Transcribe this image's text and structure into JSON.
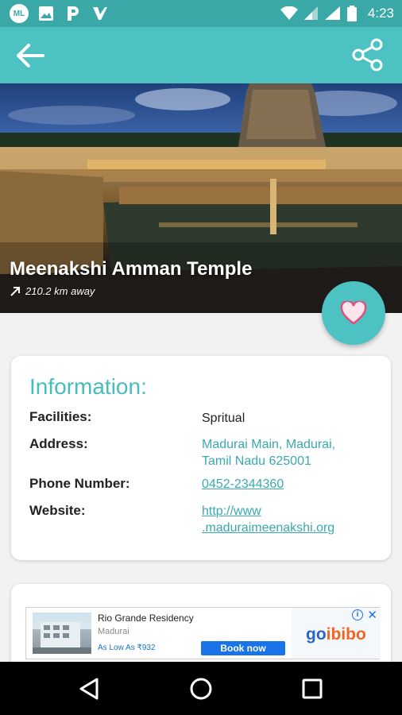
{
  "status_bar": {
    "time": "4:23",
    "notification_icons": [
      "ml-app-icon",
      "image-icon",
      "parking-icon",
      "checkmark-app-icon"
    ],
    "system_icons": [
      "wifi-icon",
      "signal-icon",
      "signal-icon",
      "battery-icon"
    ]
  },
  "app_bar": {
    "back_icon": "arrow-left-icon",
    "share_icon": "share-icon"
  },
  "place": {
    "title": "Meenakshi Amman Temple",
    "distance": "210.2 km away"
  },
  "info": {
    "heading": "Information:",
    "rows": [
      {
        "label": "Facilities:",
        "value": "Spritual"
      },
      {
        "label": "Address:",
        "value": "Madurai Main, Madurai,\nTamil Nadu 625001"
      },
      {
        "label": "Phone Number:",
        "value": "0452-2344360"
      },
      {
        "label": "Website:",
        "value": "http://www\n.maduraimeenakshi.org"
      }
    ]
  },
  "ad": {
    "hotel_name": "Rio Grande Residency",
    "city": "Madurai",
    "price": "As Low As ₹932",
    "cta": "Book now",
    "brand_go": "go",
    "brand_ibibo": "ibibo",
    "close": "✕",
    "info": "i"
  },
  "colors": {
    "primary": "#4dc2c2",
    "status_bar": "#3ba8a8",
    "link": "#3aa9b0",
    "heart": "#e64c7c"
  }
}
